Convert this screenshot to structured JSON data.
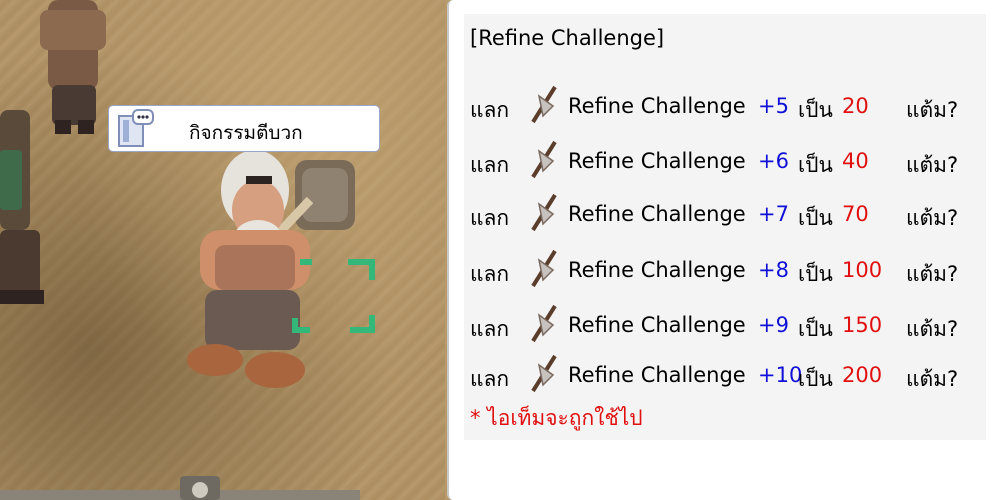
{
  "scene": {
    "npc_name": "กิจกรรมตีบวก"
  },
  "dialog": {
    "title": "[Refine Challenge]",
    "rows": [
      {
        "trade_word": "แลก",
        "item_name": "Refine Challenge",
        "level": "+5",
        "be_word": "เป็น",
        "points": "20",
        "unit": "แต้ม?"
      },
      {
        "trade_word": "แลก",
        "item_name": "Refine Challenge",
        "level": "+6",
        "be_word": "เป็น",
        "points": "40",
        "unit": "แต้ม?"
      },
      {
        "trade_word": "แลก",
        "item_name": "Refine Challenge",
        "level": "+7",
        "be_word": "เป็น",
        "points": "70",
        "unit": "แต้ม?"
      },
      {
        "trade_word": "แลก",
        "item_name": "Refine Challenge",
        "level": "+8",
        "be_word": "เป็น",
        "points": "100",
        "unit": "แต้ม?"
      },
      {
        "trade_word": "แลก",
        "item_name": "Refine Challenge",
        "level": "+9",
        "be_word": "เป็น",
        "points": "150",
        "unit": "แต้ม?"
      },
      {
        "trade_word": "แลก",
        "item_name": "Refine Challenge",
        "level": "+10",
        "be_word": "เป็น",
        "points": "200",
        "unit": "แต้ม?"
      }
    ],
    "note": "* ไอเท็มจะถูกใช้ไป"
  },
  "colors": {
    "level_blue": "#1010d8",
    "points_red": "#e01010",
    "note_red": "#e01010"
  },
  "icons": {
    "item": "axe-icon",
    "npc": "chat-window-icon"
  }
}
